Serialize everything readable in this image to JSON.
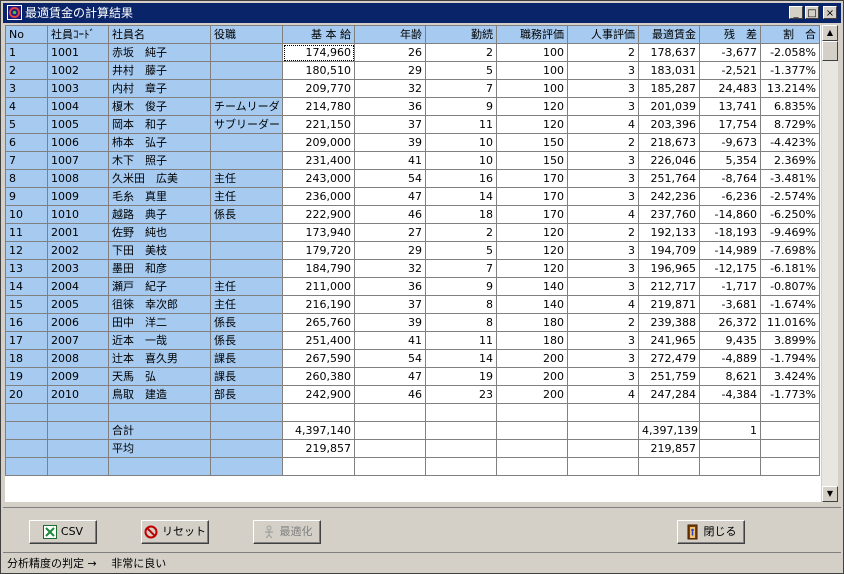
{
  "window": {
    "title": "最適賃金の計算結果",
    "minimize_glyph": "_",
    "maximize_glyph": "□",
    "close_glyph": "×"
  },
  "table": {
    "headers": [
      "No",
      "社員ｺｰﾄﾞ",
      "社員名",
      "役職",
      "基 本 給",
      "年齢",
      "勤続",
      "職務評価",
      "人事評価",
      "最適賃金",
      "残　差",
      "割　合"
    ],
    "rows": [
      [
        "1",
        "1001",
        "赤坂　純子",
        "",
        "174,960",
        "26",
        "2",
        "100",
        "2",
        "178,637",
        "-3,677",
        "-2.058%"
      ],
      [
        "2",
        "1002",
        "井村　藤子",
        "",
        "180,510",
        "29",
        "5",
        "100",
        "3",
        "183,031",
        "-2,521",
        "-1.377%"
      ],
      [
        "3",
        "1003",
        "内村　章子",
        "",
        "209,770",
        "32",
        "7",
        "100",
        "3",
        "185,287",
        "24,483",
        "13.214%"
      ],
      [
        "4",
        "1004",
        "榎木　俊子",
        "チームリーダ",
        "214,780",
        "36",
        "9",
        "120",
        "3",
        "201,039",
        "13,741",
        "6.835%"
      ],
      [
        "5",
        "1005",
        "岡本　和子",
        "サブリーダー",
        "221,150",
        "37",
        "11",
        "120",
        "4",
        "203,396",
        "17,754",
        "8.729%"
      ],
      [
        "6",
        "1006",
        "柿本　弘子",
        "",
        "209,000",
        "39",
        "10",
        "150",
        "2",
        "218,673",
        "-9,673",
        "-4.423%"
      ],
      [
        "7",
        "1007",
        "木下　照子",
        "",
        "231,400",
        "41",
        "10",
        "150",
        "3",
        "226,046",
        "5,354",
        "2.369%"
      ],
      [
        "8",
        "1008",
        "久米田　広美",
        "主任",
        "243,000",
        "54",
        "16",
        "170",
        "3",
        "251,764",
        "-8,764",
        "-3.481%"
      ],
      [
        "9",
        "1009",
        "毛糸　真里",
        "主任",
        "236,000",
        "47",
        "14",
        "170",
        "3",
        "242,236",
        "-6,236",
        "-2.574%"
      ],
      [
        "10",
        "1010",
        "越路　典子",
        "係長",
        "222,900",
        "46",
        "18",
        "170",
        "4",
        "237,760",
        "-14,860",
        "-6.250%"
      ],
      [
        "11",
        "2001",
        "佐野　純也",
        "",
        "173,940",
        "27",
        "2",
        "120",
        "2",
        "192,133",
        "-18,193",
        "-9.469%"
      ],
      [
        "12",
        "2002",
        "下田　美枝",
        "",
        "179,720",
        "29",
        "5",
        "120",
        "3",
        "194,709",
        "-14,989",
        "-7.698%"
      ],
      [
        "13",
        "2003",
        "墨田　和彦",
        "",
        "184,790",
        "32",
        "7",
        "120",
        "3",
        "196,965",
        "-12,175",
        "-6.181%"
      ],
      [
        "14",
        "2004",
        "瀬戸　紀子",
        "主任",
        "211,000",
        "36",
        "9",
        "140",
        "3",
        "212,717",
        "-1,717",
        "-0.807%"
      ],
      [
        "15",
        "2005",
        "徂徠　幸次郎",
        "主任",
        "216,190",
        "37",
        "8",
        "140",
        "4",
        "219,871",
        "-3,681",
        "-1.674%"
      ],
      [
        "16",
        "2006",
        "田中　洋二",
        "係長",
        "265,760",
        "39",
        "8",
        "180",
        "2",
        "239,388",
        "26,372",
        "11.016%"
      ],
      [
        "17",
        "2007",
        "近本　一哉",
        "係長",
        "251,400",
        "41",
        "11",
        "180",
        "3",
        "241,965",
        "9,435",
        "3.899%"
      ],
      [
        "18",
        "2008",
        "辻本　喜久男",
        "課長",
        "267,590",
        "54",
        "14",
        "200",
        "3",
        "272,479",
        "-4,889",
        "-1.794%"
      ],
      [
        "19",
        "2009",
        "天馬　弘",
        "課長",
        "260,380",
        "47",
        "19",
        "200",
        "3",
        "251,759",
        "8,621",
        "3.424%"
      ],
      [
        "20",
        "2010",
        "鳥取　建造",
        "部長",
        "242,900",
        "46",
        "23",
        "200",
        "4",
        "247,284",
        "-4,384",
        "-1.773%"
      ]
    ],
    "summary": [
      [
        "",
        "",
        "",
        "",
        "",
        "",
        "",
        "",
        "",
        "",
        "",
        ""
      ],
      [
        "",
        "",
        "合計",
        "",
        "4,397,140",
        "",
        "",
        "",
        "",
        "4,397,139",
        "1",
        ""
      ],
      [
        "",
        "",
        "平均",
        "",
        "219,857",
        "",
        "",
        "",
        "",
        "219,857",
        "",
        ""
      ],
      [
        "",
        "",
        "",
        "",
        "",
        "",
        "",
        "",
        "",
        "",
        "",
        ""
      ]
    ]
  },
  "buttons": {
    "csv": "CSV",
    "reset": "リセット",
    "optimize": "最適化",
    "close": "閉じる"
  },
  "status": {
    "text": "分析精度の判定 → 　非常に良い"
  },
  "colors": {
    "titlebar": "#0a246a",
    "fixed_cell": "#a6caf0",
    "window": "#d4d0c8"
  }
}
